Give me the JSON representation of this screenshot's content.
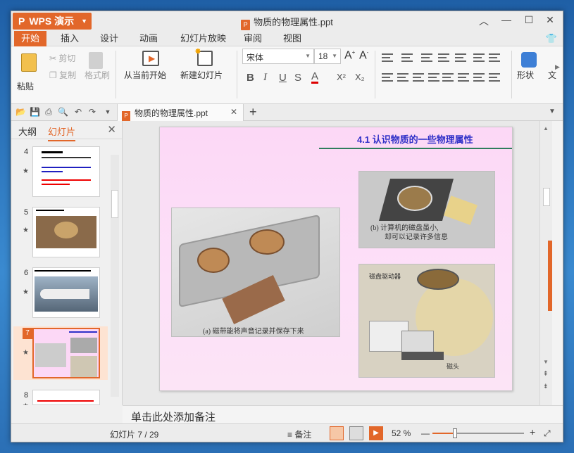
{
  "app": {
    "name": "WPS 演示",
    "window_title": "物质的物理属性.ppt"
  },
  "menu": [
    "开始",
    "插入",
    "设计",
    "动画",
    "幻灯片放映",
    "审阅",
    "视图"
  ],
  "ribbon": {
    "paste": "粘贴",
    "cut": "剪切",
    "copy": "复制",
    "format_painter": "格式刷",
    "play_from_current": "从当前开始",
    "new_slide": "新建幻灯片",
    "font_name": "宋体",
    "font_size": "18",
    "shapes": "形状",
    "text_partial": "文"
  },
  "doc_tab": {
    "name": "物质的物理属性.ppt"
  },
  "panel": {
    "outline": "大纲",
    "slides": "幻灯片"
  },
  "thumbnails": [
    {
      "num": "4"
    },
    {
      "num": "5"
    },
    {
      "num": "6"
    },
    {
      "num": "7",
      "selected": true
    },
    {
      "num": "8"
    }
  ],
  "slide": {
    "title": "4.1 认识物质的一些物理属性",
    "caption_a": "(a) 磁带能将声音记录并保存下来",
    "caption_b1": "(b) 计算机的磁盘虽小,",
    "caption_b2": "却可以记录许多信息",
    "label_drive": "磁盘驱动器",
    "label_head": "磁头"
  },
  "notes": {
    "placeholder": "单击此处添加备注"
  },
  "status": {
    "slide_counter": "幻灯片 7 / 29",
    "notes": "备注",
    "zoom": "52 %"
  },
  "colors": {
    "accent": "#e2672a",
    "slide_background": "#fcd8f6",
    "slide_title": "#3030c8",
    "title_rule": "#2e7d5c"
  }
}
